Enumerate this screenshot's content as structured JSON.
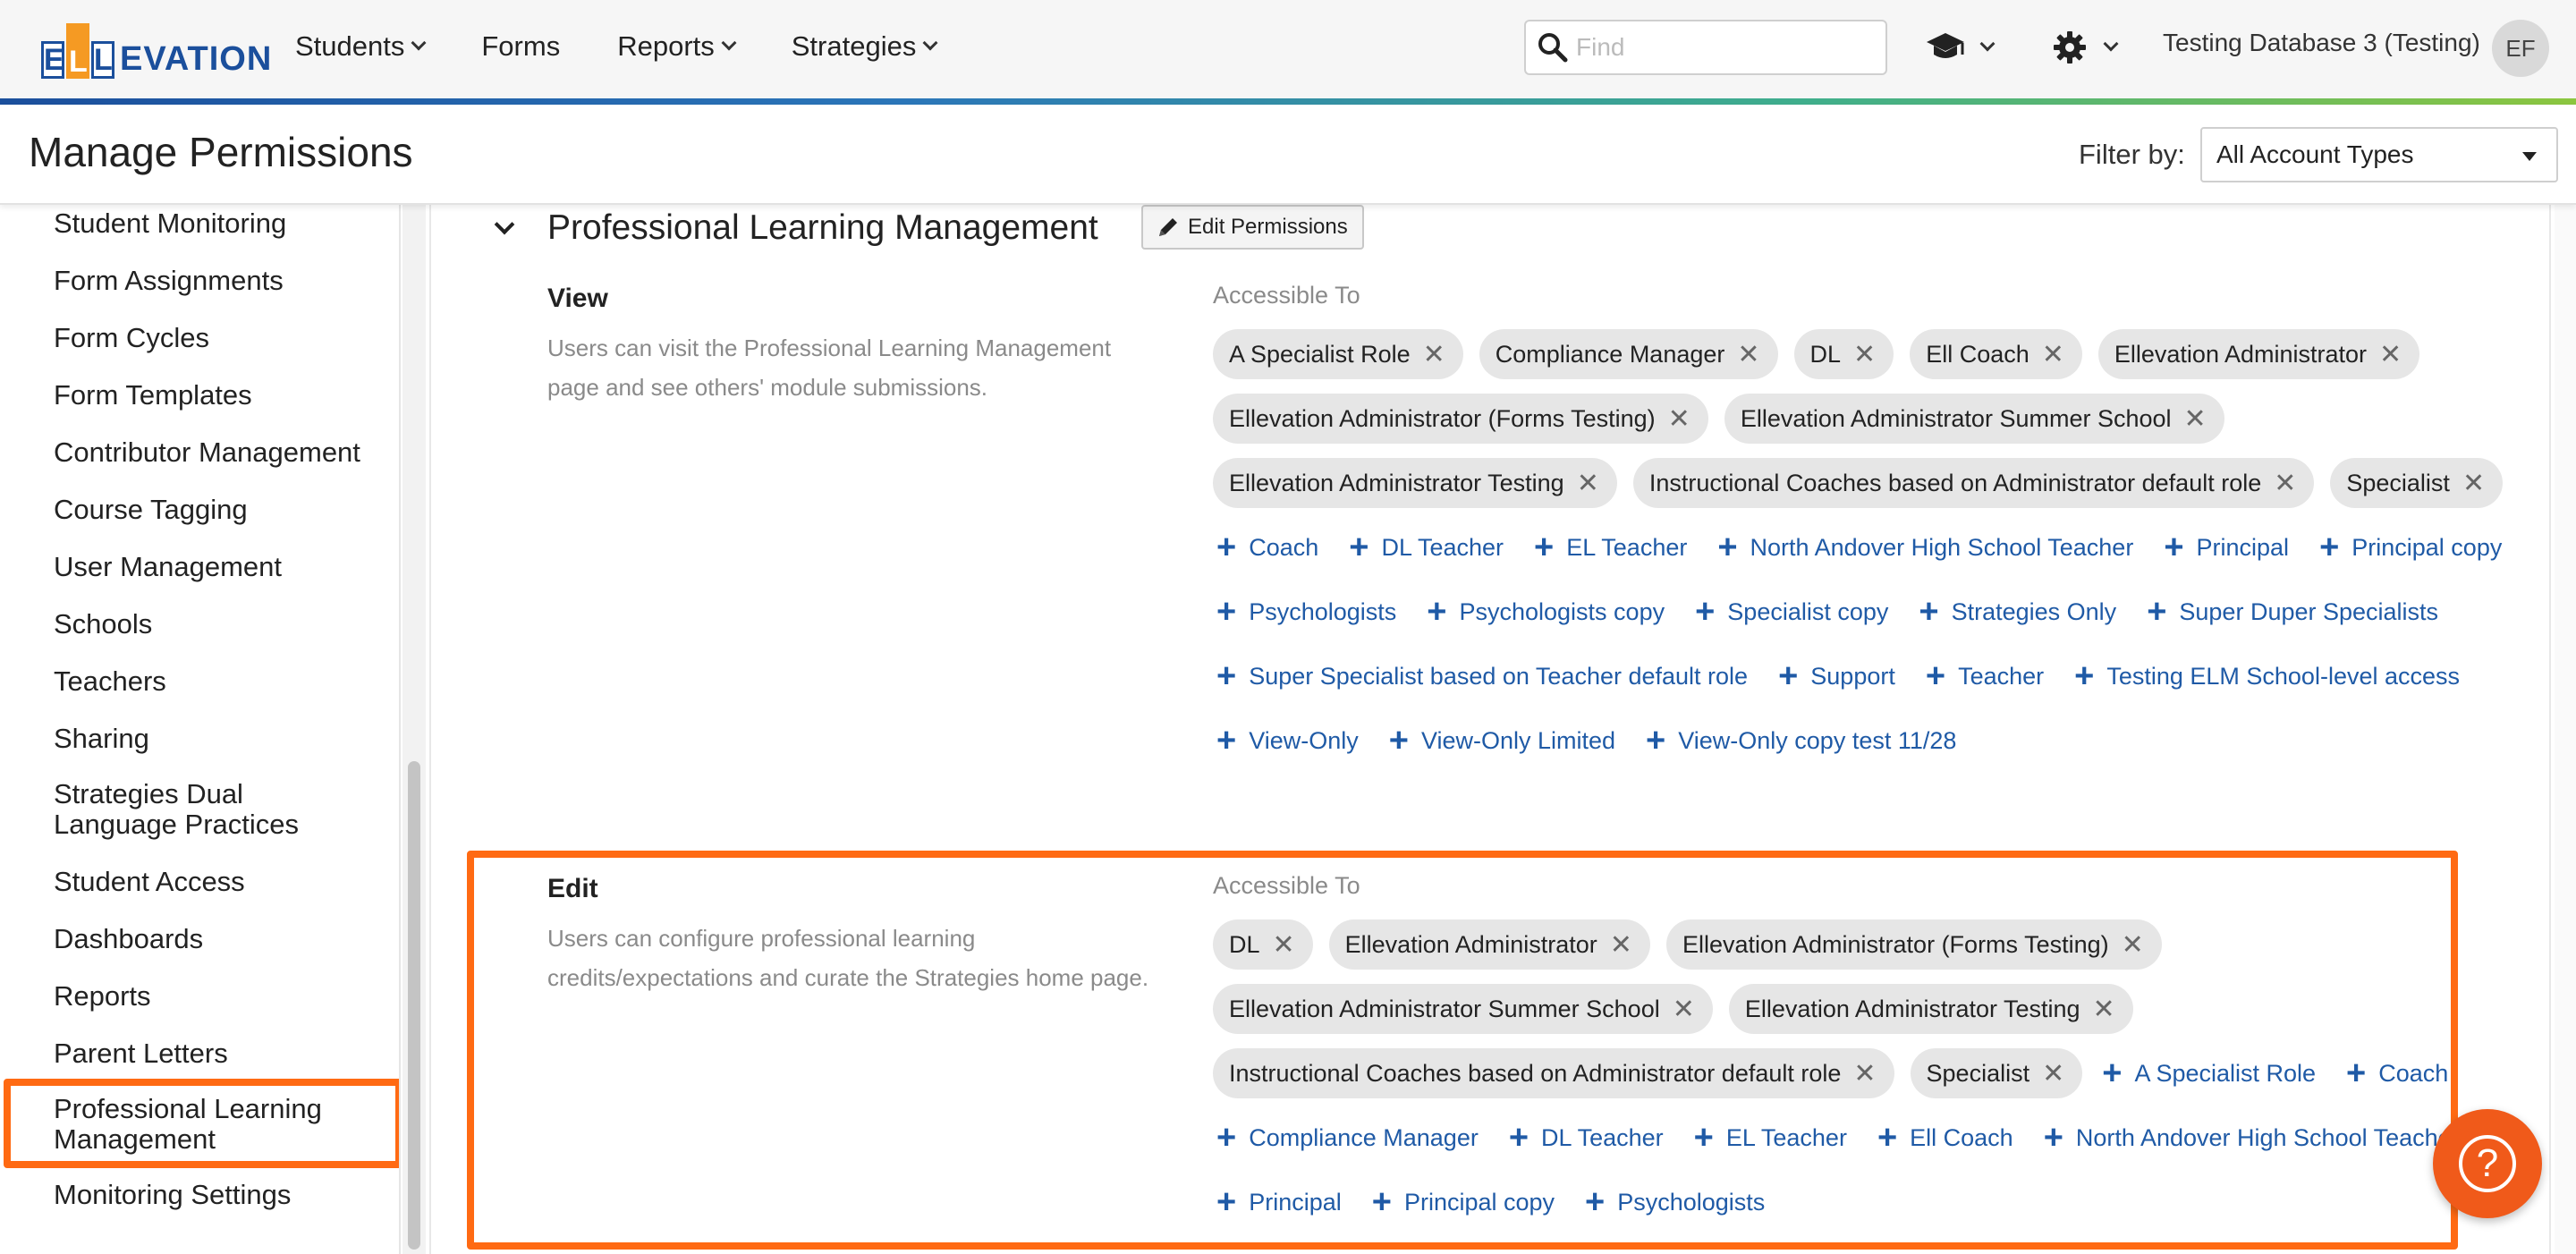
{
  "app": {
    "logo_letters": [
      "E",
      "L",
      "L"
    ],
    "logo_rest": "EVATION",
    "nav": [
      "Students",
      "Forms",
      "Reports",
      "Strategies"
    ],
    "find_placeholder": "Find",
    "database": "Testing Database 3 (Testing)",
    "avatar": "EF",
    "stripe_colors": [
      "#1b4f9c",
      "#2b76b9",
      "#3fae8c",
      "#8cc63f"
    ]
  },
  "header": {
    "title": "Manage Permissions",
    "filter_label": "Filter by:",
    "filter_value": "All Account Types"
  },
  "sidebar": {
    "items": [
      "Student Monitoring",
      "Form Assignments",
      "Form Cycles",
      "Form Templates",
      "Contributor Management",
      "Course Tagging",
      "User Management",
      "Schools",
      "Teachers",
      "Sharing",
      "Strategies Dual Language Practices",
      "Student Access",
      "Dashboards",
      "Reports",
      "Parent Letters",
      "Professional Learning Management",
      "Monitoring Settings"
    ],
    "active": "Professional Learning Management",
    "highlight_color": "#ff6a13"
  },
  "section": {
    "title": "Professional Learning Management",
    "edit_button": "Edit Permissions",
    "view": {
      "name": "View",
      "description": "Users can visit the Professional Learning Management page and see others' module submissions.",
      "accessible_label": "Accessible To",
      "granted": [
        "A Specialist Role",
        "Compliance Manager",
        "DL",
        "Ell Coach",
        "Ellevation Administrator",
        "Ellevation Administrator (Forms Testing)",
        "Ellevation Administrator Summer School",
        "Ellevation Administrator Testing",
        "Instructional Coaches based on Administrator default role",
        "Specialist"
      ],
      "available": [
        "Coach",
        "DL Teacher",
        "EL Teacher",
        "North Andover High School Teacher",
        "Principal",
        "Principal copy",
        "Psychologists",
        "Psychologists copy",
        "Specialist copy",
        "Strategies Only",
        "Super Duper Specialists",
        "Super Specialist based on Teacher default role",
        "Support",
        "Teacher",
        "Testing ELM School-level access",
        "View-Only",
        "View-Only Limited",
        "View-Only copy test 11/28"
      ]
    },
    "edit": {
      "name": "Edit",
      "description": "Users can configure professional learning credits/expectations and curate the Strategies home page.",
      "accessible_label": "Accessible To",
      "granted": [
        "DL",
        "Ellevation Administrator",
        "Ellevation Administrator (Forms Testing)",
        "Ellevation Administrator Summer School",
        "Ellevation Administrator Testing",
        "Instructional Coaches based on Administrator default role",
        "Specialist"
      ],
      "available": [
        "A Specialist Role",
        "Coach",
        "Compliance Manager",
        "DL Teacher",
        "EL Teacher",
        "Ell Coach",
        "North Andover High School Teacher",
        "Principal",
        "Principal copy",
        "Psychologists"
      ],
      "highlight_color": "#ff6a13"
    }
  },
  "help": {
    "glyph": "?"
  }
}
